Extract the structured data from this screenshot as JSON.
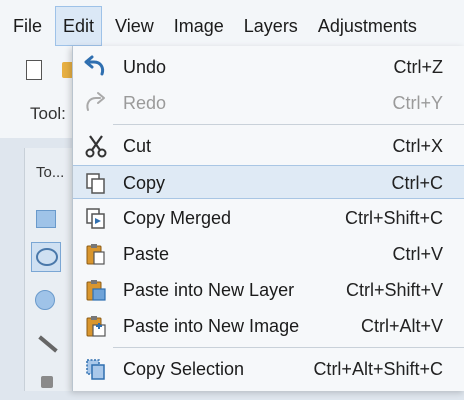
{
  "menubar": {
    "items": [
      "File",
      "Edit",
      "View",
      "Image",
      "Layers",
      "Adjustments"
    ],
    "active_index": 1
  },
  "toolbar": {
    "tools_label": "Tool:",
    "tools_panel_title": "To..."
  },
  "edit_menu": {
    "items": [
      {
        "label": "Undo",
        "shortcut": "Ctrl+Z",
        "icon": "undo-icon",
        "disabled": false
      },
      {
        "label": "Redo",
        "shortcut": "Ctrl+Y",
        "icon": "redo-icon",
        "disabled": true
      },
      {
        "label": "Cut",
        "shortcut": "Ctrl+X",
        "icon": "scissors-icon",
        "disabled": false
      },
      {
        "label": "Copy",
        "shortcut": "Ctrl+C",
        "icon": "copy-icon",
        "disabled": false,
        "highlighted": true
      },
      {
        "label": "Copy Merged",
        "shortcut": "Ctrl+Shift+C",
        "icon": "copy-merged-icon",
        "disabled": false
      },
      {
        "label": "Paste",
        "shortcut": "Ctrl+V",
        "icon": "paste-icon",
        "disabled": false
      },
      {
        "label": "Paste into New Layer",
        "shortcut": "Ctrl+Shift+V",
        "icon": "paste-new-layer-icon",
        "disabled": false
      },
      {
        "label": "Paste into New Image",
        "shortcut": "Ctrl+Alt+V",
        "icon": "paste-new-image-icon",
        "disabled": false
      },
      {
        "label": "Copy Selection",
        "shortcut": "Ctrl+Alt+Shift+C",
        "icon": "copy-selection-icon",
        "disabled": false
      }
    ]
  },
  "colors": {
    "accent": "#2f6fb0",
    "highlight": "#dfeaf5",
    "disabled_text": "#9a9a9a"
  }
}
